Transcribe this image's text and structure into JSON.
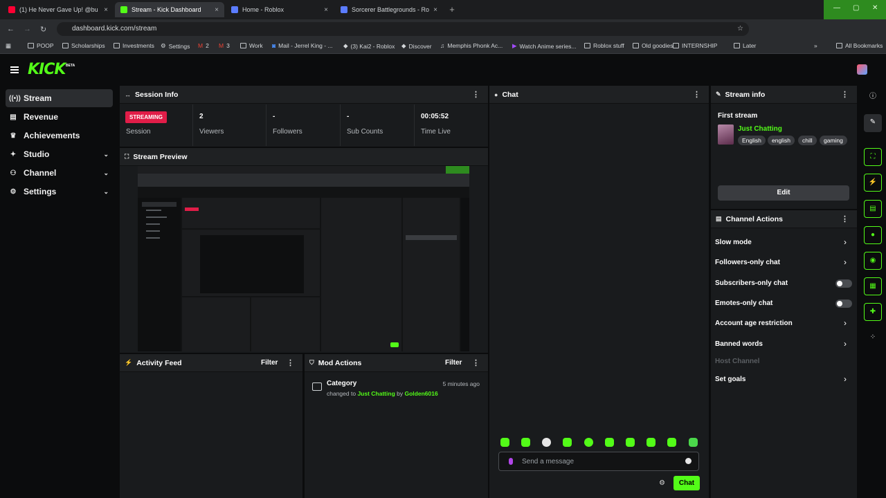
{
  "browser": {
    "tabs": [
      {
        "label": "(1) He Never Gave Up! @bu",
        "color": "#ff0033"
      },
      {
        "label": "Stream - Kick Dashboard",
        "color": "#53fc18"
      },
      {
        "label": "Home - Roblox",
        "color": "#5b7cff"
      },
      {
        "label": "Sorcerer Battlegrounds - Roblox",
        "color": "#5b7cff"
      }
    ],
    "tab_close": "×",
    "new_tab": "+",
    "url": "dashboard.kick.com/stream",
    "bookmarks": [
      "POOP",
      "Scholarships",
      "Investments",
      "Settings",
      "2",
      "3",
      "Work",
      "Mail - Jerrel King - ...",
      "(3) Kai2 - Roblox",
      "Discover",
      "Memphis Phonk Ac...",
      "Watch Anime series...",
      "Roblox stuff",
      "Old goodies",
      "INTERNSHIP",
      "Later",
      "All Bookmarks"
    ],
    "more_bookmarks": "»"
  },
  "kick": {
    "logo": "KICK",
    "beta": "BETA",
    "sidebar": [
      {
        "label": "Stream",
        "icon": "broadcast-icon",
        "glyph": "((•))",
        "expandable": false
      },
      {
        "label": "Revenue",
        "icon": "revenue-icon",
        "glyph": "▤",
        "expandable": false
      },
      {
        "label": "Achievements",
        "icon": "trophy-icon",
        "glyph": "♛",
        "expandable": false
      },
      {
        "label": "Studio",
        "icon": "studio-icon",
        "glyph": "✦",
        "expandable": true
      },
      {
        "label": "Channel",
        "icon": "channel-icon",
        "glyph": "⚇",
        "expandable": true
      },
      {
        "label": "Settings",
        "icon": "gear-icon",
        "glyph": "⚙",
        "expandable": true
      }
    ],
    "chevron": "⌄",
    "session": {
      "title": "Session Info",
      "badge": "STREAMING",
      "badge_label": "Session",
      "stats": [
        {
          "value": "2",
          "label": "Viewers"
        },
        {
          "value": "-",
          "label": "Followers"
        },
        {
          "value": "-",
          "label": "Sub Counts"
        },
        {
          "value": "00:05:52",
          "label": "Time Live"
        }
      ]
    },
    "preview_title": "Stream Preview",
    "activity": {
      "title": "Activity Feed",
      "filter": "Filter"
    },
    "mod": {
      "title": "Mod Actions",
      "filter": "Filter",
      "entry": {
        "title": "Category",
        "time": "5 minutes ago",
        "prefix": "changed to",
        "category": "Just Chatting",
        "by": "by",
        "user": "Golden6016"
      }
    },
    "chat": {
      "title": "Chat",
      "placeholder": "Send a message",
      "send": "Chat",
      "emote_count": 10
    },
    "stream_info": {
      "title": "Stream info",
      "stream_title": "First stream",
      "category": "Just Chatting",
      "tags": [
        "English",
        "english",
        "chill",
        "gaming"
      ],
      "edit": "Edit"
    },
    "channel_actions": {
      "title": "Channel Actions",
      "items": [
        {
          "label": "Slow mode",
          "control": "chevron"
        },
        {
          "label": "Followers-only chat",
          "control": "chevron"
        },
        {
          "label": "Subscribers-only chat",
          "control": "toggle"
        },
        {
          "label": "Emotes-only chat",
          "control": "toggle"
        },
        {
          "label": "Account age restriction",
          "control": "chevron"
        },
        {
          "label": "Banned words",
          "control": "chevron"
        },
        {
          "label": "Host Channel",
          "control": "disabled"
        },
        {
          "label": "Set goals",
          "control": "chevron"
        }
      ]
    },
    "rail_icons": [
      "info-icon",
      "pencil-icon",
      "fullscreen-icon",
      "lightning-icon",
      "notes-icon",
      "chat-bubble-icon",
      "broadcast-icon",
      "layout-icon",
      "wrench-icon",
      "dots-icon"
    ],
    "accent": "#53fc18",
    "streaming_red": "#e11d48"
  }
}
